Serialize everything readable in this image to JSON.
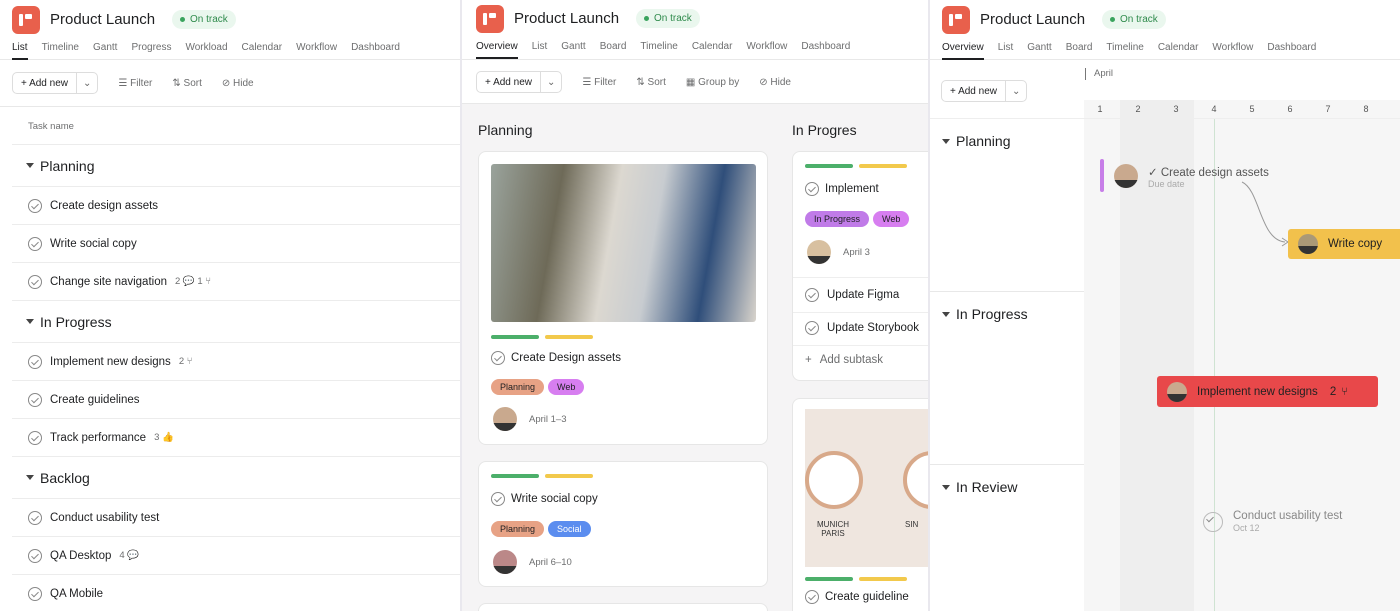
{
  "project": {
    "title": "Product Launch",
    "status": "On track"
  },
  "list_view": {
    "tabs": [
      "List",
      "Timeline",
      "Gantt",
      "Progress",
      "Workload",
      "Calendar",
      "Workflow",
      "Dashboard"
    ],
    "toolbar": {
      "add_new": "+ Add new",
      "filter": "Filter",
      "sort": "Sort",
      "hide": "Hide"
    },
    "column": "Task name",
    "sections": [
      {
        "name": "Planning",
        "tasks": [
          {
            "name": "Create design assets",
            "meta": ""
          },
          {
            "name": "Write social copy",
            "meta": ""
          },
          {
            "name": "Change site navigation",
            "meta": "2 💬   1 ⑂"
          }
        ]
      },
      {
        "name": "In Progress",
        "tasks": [
          {
            "name": "Implement new designs",
            "meta": "2 ⑂"
          },
          {
            "name": "Create guidelines",
            "meta": ""
          },
          {
            "name": "Track performance",
            "meta": "3 👍"
          }
        ]
      },
      {
        "name": "Backlog",
        "tasks": [
          {
            "name": "Conduct usability test",
            "meta": ""
          },
          {
            "name": "QA Desktop",
            "meta": "4 💬"
          },
          {
            "name": "QA Mobile",
            "meta": ""
          }
        ]
      }
    ]
  },
  "board_view": {
    "tabs": [
      "Overview",
      "List",
      "Gantt",
      "Board",
      "Timeline",
      "Calendar",
      "Workflow",
      "Dashboard"
    ],
    "toolbar": {
      "add_new": "+ Add new",
      "filter": "Filter",
      "sort": "Sort",
      "group_by": "Group by",
      "hide": "Hide"
    },
    "columns": [
      "Planning",
      "In Progres"
    ],
    "cards": [
      {
        "title": "Create Design assets",
        "tags": [
          "Planning",
          "Web"
        ],
        "date": "April 1–3"
      },
      {
        "title": "Write social copy",
        "tags": [
          "Planning",
          "Social"
        ],
        "date": "April 6–10"
      },
      {
        "title": "Implement",
        "tags": [
          "In Progress",
          "Web"
        ],
        "date": "April 3",
        "subtasks": [
          "Update Figma",
          "Update Storybook"
        ],
        "add_subtask": "Add subtask"
      },
      {
        "title": "Create guideline",
        "clock_label": "MUNICH PARIS",
        "clock_label2": "SIN"
      }
    ]
  },
  "timeline_view": {
    "tabs": [
      "Overview",
      "List",
      "Gantt",
      "Board",
      "Timeline",
      "Calendar",
      "Workflow",
      "Dashboard"
    ],
    "add_new": "+ Add new",
    "month": "April",
    "days": [
      "1",
      "2",
      "3",
      "4",
      "5",
      "6",
      "7",
      "8"
    ],
    "sections": [
      "Planning",
      "In Progress",
      "In Review"
    ],
    "items": {
      "design": "Create design assets",
      "design_sub": "Due date",
      "write": "Write copy",
      "implement": "Implement new designs",
      "implement_count": "2",
      "usability": "Conduct usability test",
      "usability_date": "Oct 12"
    }
  },
  "colors": {
    "accent": "#e8604c",
    "green": "#4caf6a",
    "yellow": "#f2c94c",
    "planning": "#e7a285",
    "web": "#d77ef0",
    "social": "#5b8def",
    "inprogress": "#c07be8",
    "red": "#e8484a"
  }
}
